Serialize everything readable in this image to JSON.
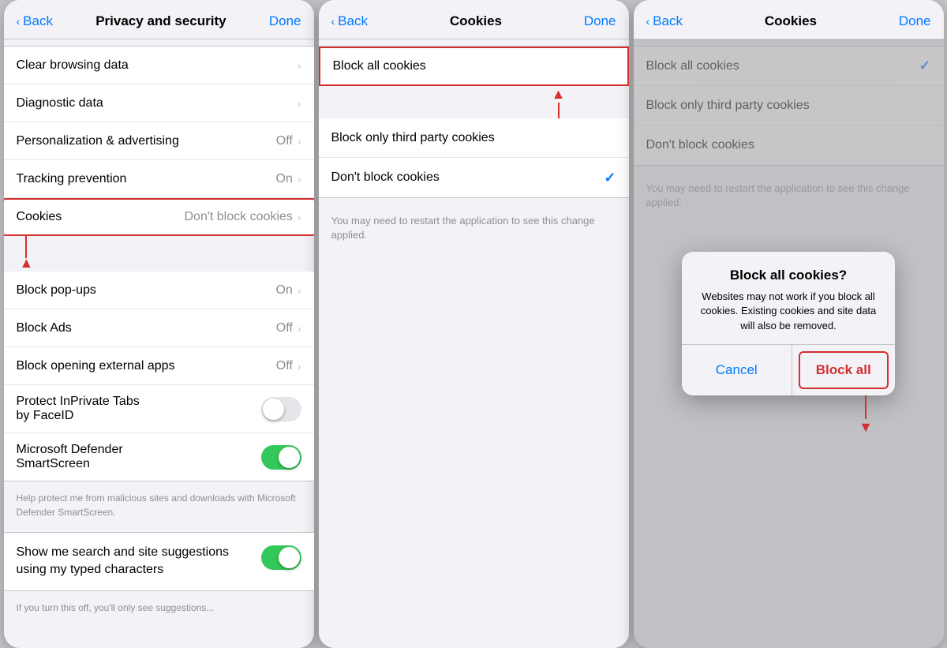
{
  "screens": [
    {
      "id": "privacy-security",
      "nav": {
        "back_label": "Back",
        "title": "Privacy and security",
        "done_label": "Done"
      },
      "rows": [
        {
          "id": "clear-browsing",
          "label": "Clear browsing data",
          "value": "",
          "has_chevron": true,
          "type": "nav"
        },
        {
          "id": "diagnostic-data",
          "label": "Diagnostic data",
          "value": "",
          "has_chevron": true,
          "type": "nav"
        },
        {
          "id": "personalization",
          "label": "Personalization & advertising",
          "value": "Off",
          "has_chevron": true,
          "type": "nav"
        },
        {
          "id": "tracking-prevention",
          "label": "Tracking prevention",
          "value": "On",
          "has_chevron": true,
          "type": "nav"
        },
        {
          "id": "cookies",
          "label": "Cookies",
          "value": "Don't block cookies",
          "has_chevron": true,
          "type": "nav",
          "highlighted": true
        },
        {
          "id": "block-popups",
          "label": "Block pop-ups",
          "value": "On",
          "has_chevron": true,
          "type": "nav"
        },
        {
          "id": "block-ads",
          "label": "Block Ads",
          "value": "Off",
          "has_chevron": true,
          "type": "nav"
        },
        {
          "id": "block-external",
          "label": "Block opening external apps",
          "value": "Off",
          "has_chevron": true,
          "type": "nav"
        },
        {
          "id": "protect-inprivate",
          "label": "Protect InPrivate Tabs\nby FaceID",
          "value": "",
          "has_chevron": false,
          "type": "toggle",
          "toggle_on": false
        },
        {
          "id": "defender",
          "label": "Microsoft Defender\nSmartScreen",
          "value": "",
          "has_chevron": false,
          "type": "toggle",
          "toggle_on": true
        },
        {
          "id": "defender-help",
          "label": "Help protect me from malicious sites and downloads with Microsoft Defender SmartScreen.",
          "value": "",
          "type": "helper"
        },
        {
          "id": "search-suggestions",
          "label": "Show me search and site suggestions using my typed characters",
          "value": "",
          "has_chevron": false,
          "type": "toggle",
          "toggle_on": true
        }
      ]
    },
    {
      "id": "cookies-screen",
      "nav": {
        "back_label": "Back",
        "title": "Cookies",
        "done_label": "Done"
      },
      "options": [
        {
          "id": "block-all",
          "label": "Block all cookies",
          "selected": false,
          "highlighted": true
        },
        {
          "id": "block-third-party",
          "label": "Block only third party cookies",
          "selected": false
        },
        {
          "id": "dont-block",
          "label": "Don't block cookies",
          "selected": true
        }
      ],
      "helper_text": "You may need to restart the application to see this change applied."
    },
    {
      "id": "cookies-screen-2",
      "nav": {
        "back_label": "Back",
        "title": "Cookies",
        "done_label": "Done"
      },
      "options": [
        {
          "id": "block-all",
          "label": "Block all cookies",
          "selected": true
        },
        {
          "id": "block-third-party",
          "label": "Block only third party cookies",
          "selected": false
        },
        {
          "id": "dont-block",
          "label": "Don't block cookies",
          "selected": false
        }
      ],
      "helper_text": "You may need to restart the application to see this change applied.",
      "dialog": {
        "title": "Block all cookies?",
        "message": "Websites may not work if you block all cookies. Existing cookies and site data will also be removed.",
        "cancel_label": "Cancel",
        "confirm_label": "Block all"
      }
    }
  ]
}
